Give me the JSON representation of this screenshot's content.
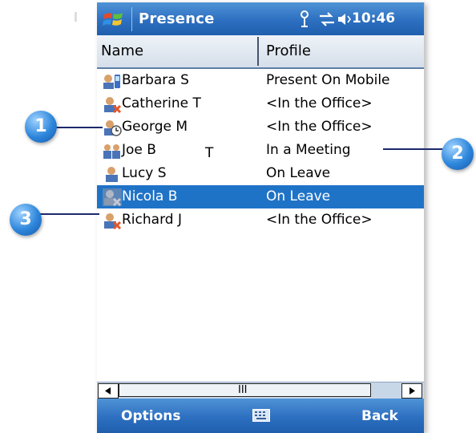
{
  "app": {
    "title": "Presence",
    "time": "10:46"
  },
  "columns": {
    "name": "Name",
    "profile": "Profile"
  },
  "contacts": [
    {
      "name": "Barbara S",
      "profile": "Present On Mobile",
      "icon": "mobile-contact-icon"
    },
    {
      "name": "Catherine T",
      "profile": "<In the Office>",
      "icon": "busy-contact-icon"
    },
    {
      "name": "George M",
      "profile": "<In the Office>",
      "icon": "away-contact-icon"
    },
    {
      "name": "Joe B",
      "profile": "In a Meeting",
      "icon": "meeting-contact-icon"
    },
    {
      "name": "Lucy S",
      "profile": "On Leave",
      "icon": "offline-contact-icon"
    },
    {
      "name": "Nicola B",
      "profile": "On Leave",
      "icon": "selected-contact-icon",
      "selected": true
    },
    {
      "name": "Richard J",
      "profile": "<In the Office>",
      "icon": "busy-contact-icon"
    }
  ],
  "cursor_glyph": "T",
  "scrollbar": {
    "grip": "III"
  },
  "softkeys": {
    "left": "Options",
    "right": "Back"
  },
  "callouts": [
    "1",
    "2",
    "3"
  ],
  "colors": {
    "titlebar": "#2d6fc0",
    "selection": "#1f73c7",
    "callout": "#2d86db"
  }
}
